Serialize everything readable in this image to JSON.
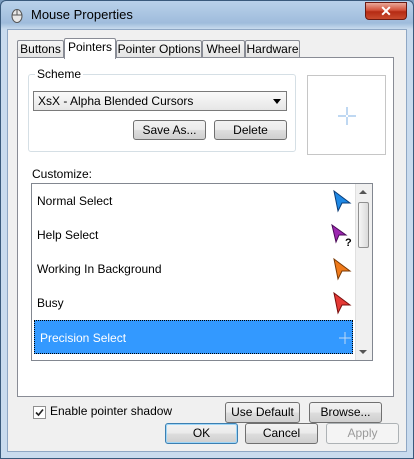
{
  "window": {
    "title": "Mouse Properties",
    "close_label": "✕"
  },
  "tabs": [
    {
      "label": "Buttons",
      "active": false
    },
    {
      "label": "Pointers",
      "active": true
    },
    {
      "label": "Pointer Options",
      "active": false
    },
    {
      "label": "Wheel",
      "active": false
    },
    {
      "label": "Hardware",
      "active": false
    }
  ],
  "scheme": {
    "label": "Scheme",
    "selected": "XsX - Alpha Blended Cursors",
    "save_as_label": "Save As...",
    "delete_label": "Delete"
  },
  "customize": {
    "label": "Customize:",
    "items": [
      {
        "label": "Normal Select",
        "icon": "blue-arrow-cursor-icon",
        "color": "#1e88e5",
        "selected": false
      },
      {
        "label": "Help Select",
        "icon": "purple-help-cursor-icon",
        "color": "#9c27b0",
        "selected": false
      },
      {
        "label": "Working In Background",
        "icon": "orange-working-cursor-icon",
        "color": "#ef7a1a",
        "selected": false
      },
      {
        "label": "Busy",
        "icon": "red-busy-cursor-icon",
        "color": "#e53935",
        "selected": false
      },
      {
        "label": "Precision Select",
        "icon": "crosshair-icon",
        "color": "#7fb2e6",
        "selected": true
      }
    ]
  },
  "pointer_shadow": {
    "label": "Enable pointer shadow",
    "checked": true
  },
  "use_default_label": "Use Default",
  "browse_label": "Browse...",
  "footer": {
    "ok_label": "OK",
    "cancel_label": "Cancel",
    "apply_label": "Apply"
  }
}
